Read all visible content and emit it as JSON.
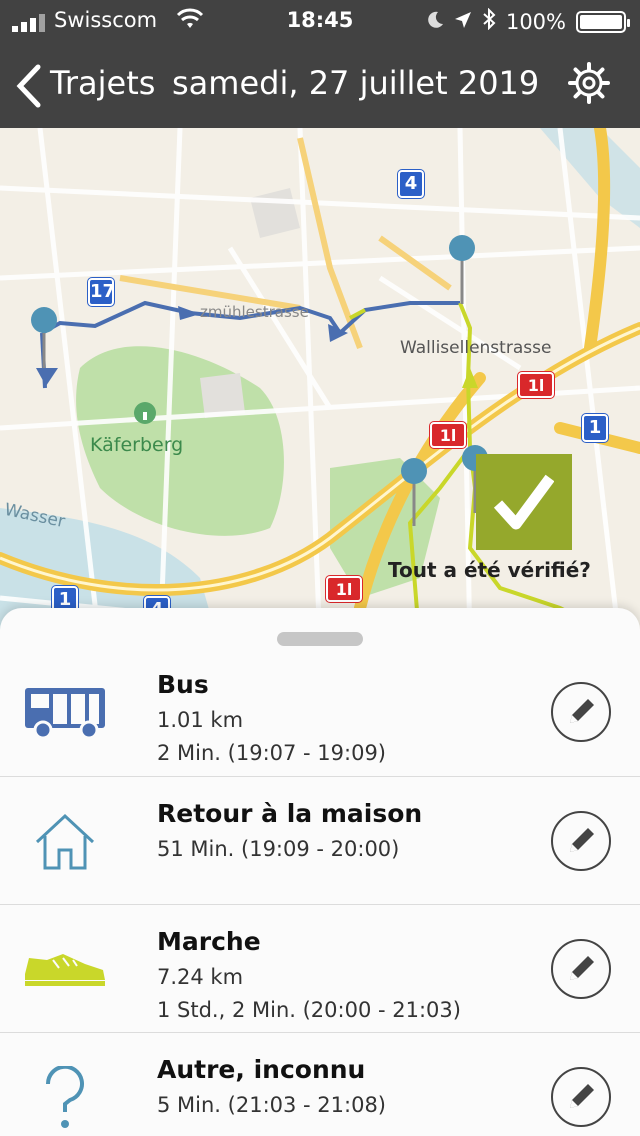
{
  "status_bar": {
    "carrier": "Swisscom",
    "time": "18:45",
    "battery": "100%"
  },
  "header": {
    "title": "Trajets",
    "date": "samedi, 27 juillet 2019"
  },
  "map": {
    "street_label": "Wallisellenstrasse",
    "street_label_2": "zmühlestrasse",
    "park_label": "Käferberg",
    "water_label": "Wasser",
    "signs": {
      "s4": "4",
      "s17": "17",
      "s1a": "1",
      "s1b": "1",
      "s4b": "4",
      "r11a": "1l",
      "r11b": "1l",
      "r11c": "1l"
    },
    "verify_label": "Tout a été vérifié?",
    "colors": {
      "bus_track": "#4a6eb0",
      "walk_track": "#c9d72a",
      "verified": "#95a82c"
    }
  },
  "trips": [
    {
      "icon": "bus-icon",
      "title": "Bus",
      "lines": [
        "1.01 km",
        "2 Min. (19:07 - 19:09)"
      ]
    },
    {
      "icon": "home-icon",
      "title": "Retour à la maison",
      "lines": [
        "51 Min. (19:09 - 20:00)"
      ]
    },
    {
      "icon": "shoe-icon",
      "title": "Marche",
      "lines": [
        "7.24 km",
        "1 Std., 2 Min. (20:00 - 21:03)"
      ]
    },
    {
      "icon": "question-icon",
      "title": "Autre, inconnu",
      "lines": [
        "5 Min. (21:03 - 21:08)"
      ]
    }
  ]
}
